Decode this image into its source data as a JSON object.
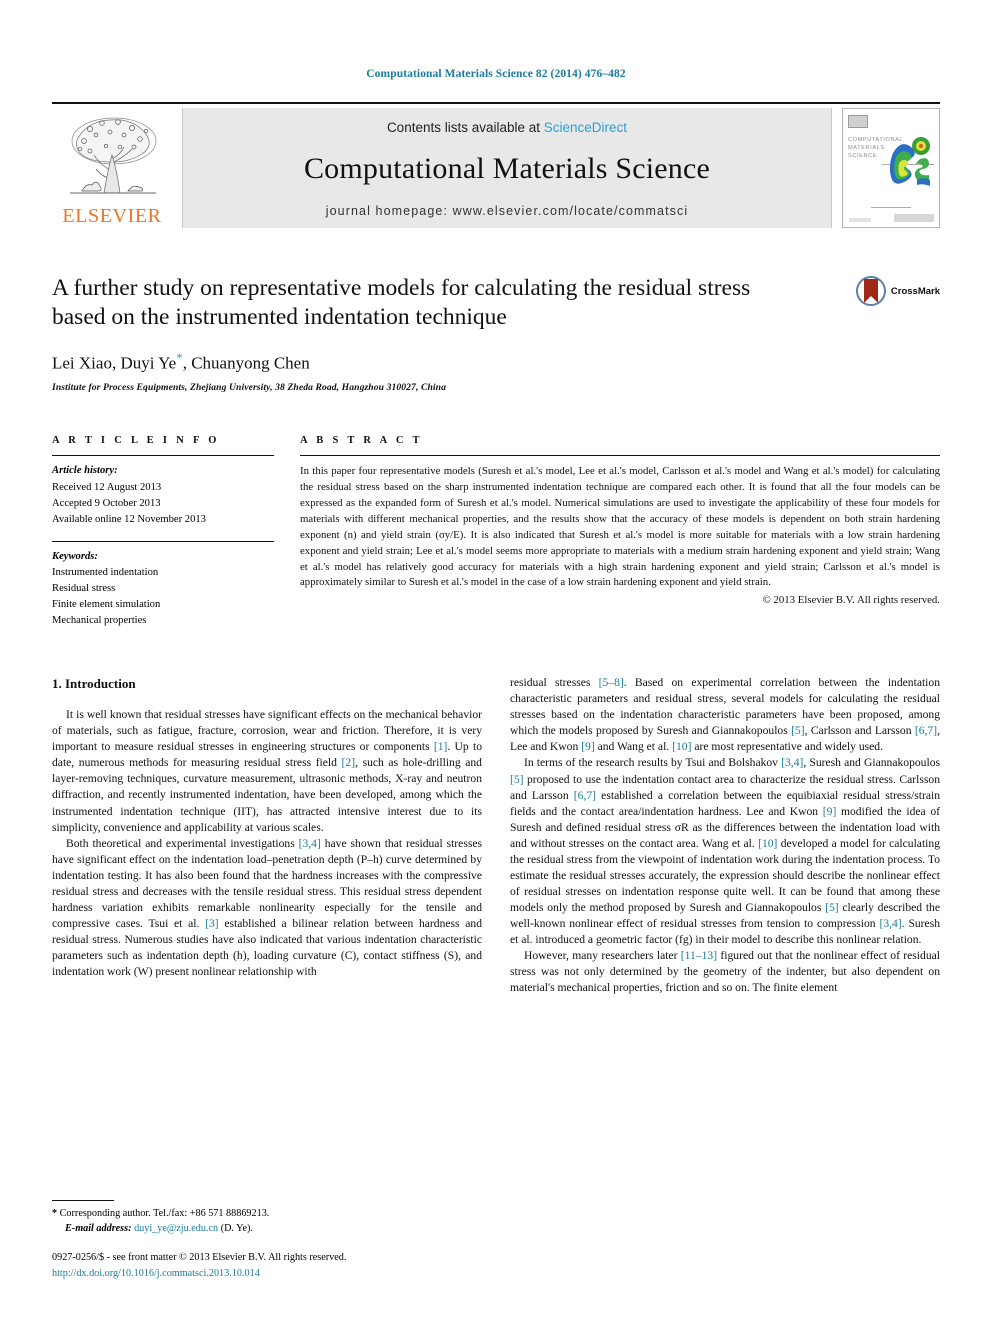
{
  "running_head": "Computational Materials Science 82 (2014) 476–482",
  "masthead": {
    "contents_prefix": "Contents lists available at ",
    "sciencedirect": "ScienceDirect",
    "journal_title": "Computational Materials Science",
    "homepage": "journal homepage: www.elsevier.com/locate/commatsci",
    "publisher_name": "ELSEVIER",
    "cover_line1": "COMPUTATIONAL",
    "cover_line2": "MATERIALS",
    "cover_line3": "SCIENCE"
  },
  "article": {
    "title": "A further study on representative models for calculating the residual stress based on the instrumented indentation technique",
    "authors_part1": "Lei Xiao, Duyi Ye",
    "authors_star": "*",
    "authors_part2": ", Chuanyong Chen",
    "affiliation": "Institute for Process Equipments, Zhejiang University, 38 Zheda Road, Hangzhou 310027, China",
    "crossmark_label": "CrossMark"
  },
  "info": {
    "heading": "A R T I C L E    I N F O",
    "history_label": "Article history:",
    "history": [
      "Received 12 August 2013",
      "Accepted 9 October 2013",
      "Available online 12 November 2013"
    ],
    "keywords_label": "Keywords:",
    "keywords": [
      "Instrumented indentation",
      "Residual stress",
      "Finite element simulation",
      "Mechanical properties"
    ]
  },
  "abstract": {
    "heading": "A B S T R A C T",
    "text": "In this paper four representative models (Suresh et al.'s model, Lee et al.'s model, Carlsson et al.'s model and Wang et al.'s model) for calculating the residual stress based on the sharp instrumented indentation technique are compared each other. It is found that all the four models can be expressed as the expanded form of Suresh et al.'s model. Numerical simulations are used to investigate the applicability of these four models for materials with different mechanical properties, and the results show that the accuracy of these models is dependent on both strain hardening exponent (n) and yield strain (σy/E). It is also indicated that Suresh et al.'s model is more suitable for materials with a low strain hardening exponent and yield strain; Lee et al.'s model seems more appropriate to materials with a medium strain hardening exponent and yield strain; Wang et al.'s model has relatively good accuracy for materials with a high strain hardening exponent and yield strain; Carlsson et al.'s model is approximately similar to Suresh et al.'s model in the case of a low strain hardening exponent and yield strain.",
    "copyright": "© 2013 Elsevier B.V. All rights reserved."
  },
  "body": {
    "section_title": "1. Introduction",
    "left_paragraphs": [
      "It is well known that residual stresses have significant effects on the mechanical behavior of materials, such as fatigue, fracture, corrosion, wear and friction. Therefore, it is very important to measure residual stresses in engineering structures or components [1]. Up to date, numerous methods for measuring residual stress field [2], such as hole-drilling and layer-removing techniques, curvature measurement, ultrasonic methods, X-ray and neutron diffraction, and recently instrumented indentation, have been developed, among which the instrumented indentation technique (IIT), has attracted intensive interest due to its simplicity, convenience and applicability at various scales.",
      "Both theoretical and experimental investigations [3,4] have shown that residual stresses have significant effect on the indentation load–penetration depth (P–h) curve determined by indentation testing. It has also been found that the hardness increases with the compressive residual stress and decreases with the tensile residual stress. This residual stress dependent hardness variation exhibits remarkable nonlinearity especially for the tensile and compressive cases. Tsui et al. [3] established a bilinear relation between hardness and residual stress. Numerous studies have also indicated that various indentation characteristic parameters such as indentation depth (h), loading curvature (C), contact stiffness (S), and indentation work (W) present nonlinear relationship with"
    ],
    "right_paragraphs": [
      "residual stresses [5–8]. Based on experimental correlation between the indentation characteristic parameters and residual stress, several models for calculating the residual stresses based on the indentation characteristic parameters have been proposed, among which the models proposed by Suresh and Giannakopoulos [5], Carlsson and Larsson [6,7], Lee and Kwon [9] and Wang et al. [10] are most representative and widely used.",
      "In terms of the research results by Tsui and Bolshakov [3,4], Suresh and Giannakopoulos [5] proposed to use the indentation contact area to characterize the residual stress. Carlsson and Larsson [6,7] established a correlation between the equibiaxial residual stress/strain fields and the contact area/indentation hardness. Lee and Kwon [9] modified the idea of Suresh and defined residual stress σR as the differences between the indentation load with and without stresses on the contact area. Wang et al. [10] developed a model for calculating the residual stress from the viewpoint of indentation work during the indentation process. To estimate the residual stresses accurately, the expression should describe the nonlinear effect of residual stresses on indentation response quite well. It can be found that among these models only the method proposed by Suresh and Giannakopoulos [5] clearly described the well-known nonlinear effect of residual stresses from tension to compression [3,4]. Suresh et al. introduced a geometric factor (fg) in their model to describe this nonlinear relation.",
      "However, many researchers later [11–13] figured out that the nonlinear effect of residual stress was not only determined by the geometry of the indenter, but also dependent on material's mechanical properties, friction and so on. The finite element"
    ]
  },
  "footer": {
    "corresponding_marker": "*",
    "corresponding": "Corresponding author. Tel./fax: +86 571 88869213.",
    "email_label": "E-mail address:",
    "email": "duyi_ye@zju.edu.cn",
    "email_suffix": " (D. Ye).",
    "issn_line": "0927-0256/$ - see front matter © 2013 Elsevier B.V. All rights reserved.",
    "doi": "http://dx.doi.org/10.1016/j.commatsci.2013.10.014"
  },
  "colors": {
    "link_teal": "#1a7b9e",
    "sciencedirect_blue": "#2a9fd6",
    "elsevier_orange": "#E87722",
    "masthead_gray": "#e8e8e8"
  }
}
